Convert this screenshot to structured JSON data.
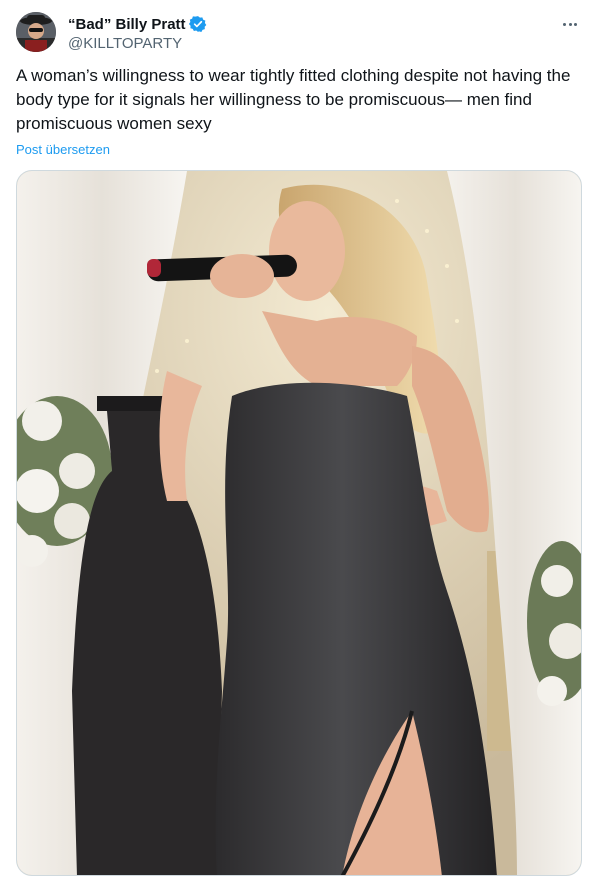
{
  "author": {
    "display_name": "“Bad” Billy Pratt",
    "handle": "@KILLTOPARTY",
    "verified": true,
    "verified_color": "#1d9bf0"
  },
  "tweet": {
    "text": "A woman’s willingness to wear tightly fitted clothing despite not having the body type for it signals her willingness to be promiscuous— men find promiscuous women sexy",
    "translate_label": "Post übersetzen"
  },
  "icons": {
    "more": "more-horizontal-icon",
    "verified": "verified-badge-icon"
  },
  "colors": {
    "text": "#0f1419",
    "secondary": "#536471",
    "link": "#1d9bf0"
  }
}
